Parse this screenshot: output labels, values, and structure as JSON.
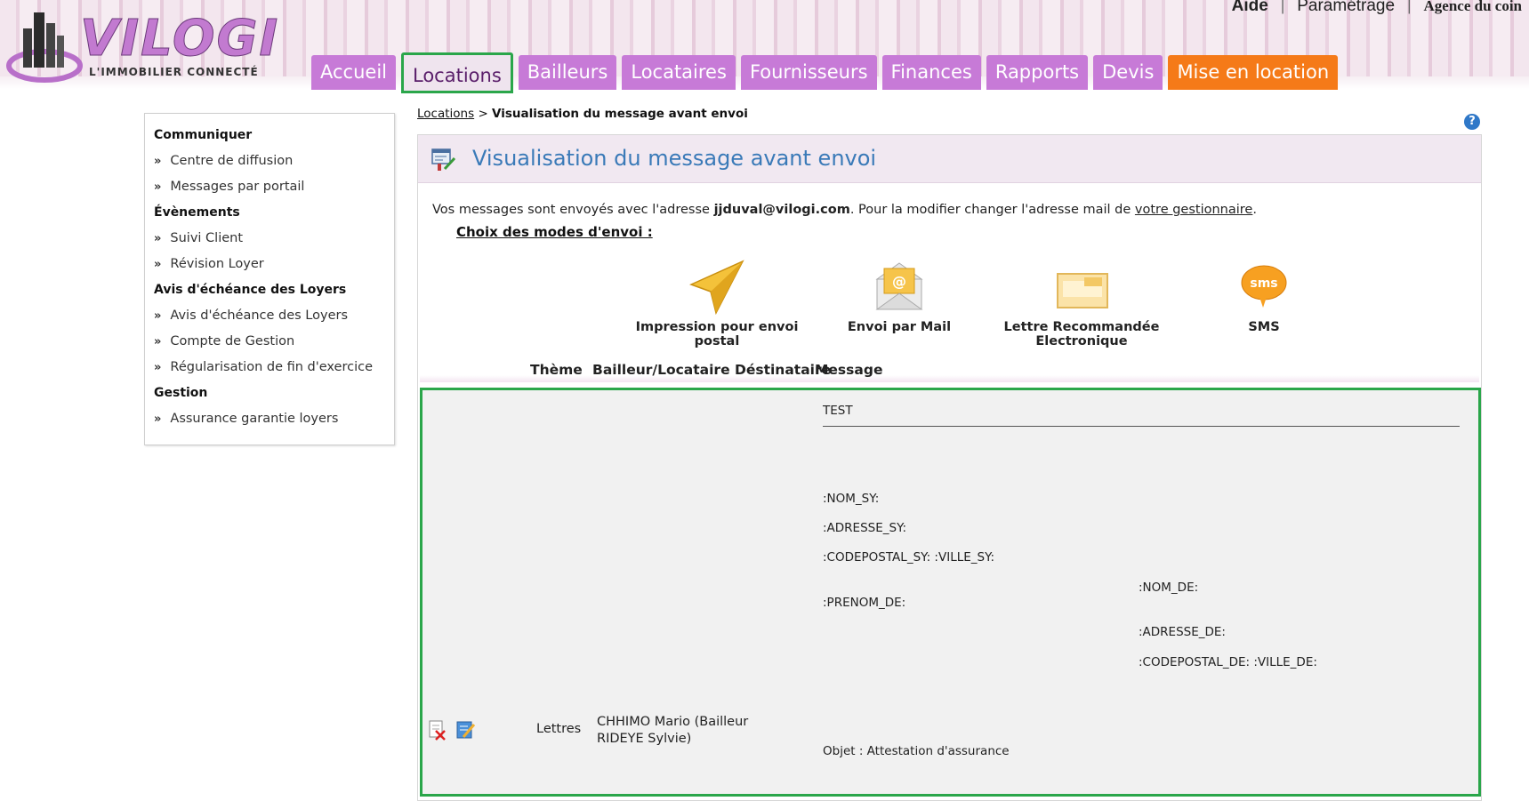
{
  "header": {
    "logo": {
      "brand": "VILOGI",
      "tagline": "L'IMMOBILIER CONNECTÉ"
    },
    "top_links": {
      "aide": "Aide",
      "parametrage": "Paramétrage",
      "agency": "Agence du coin",
      "separator": "|"
    },
    "tabs": [
      {
        "label": "Accueil",
        "state": "normal"
      },
      {
        "label": "Locations",
        "state": "active"
      },
      {
        "label": "Bailleurs",
        "state": "normal"
      },
      {
        "label": "Locataires",
        "state": "normal"
      },
      {
        "label": "Fournisseurs",
        "state": "normal"
      },
      {
        "label": "Finances",
        "state": "normal"
      },
      {
        "label": "Rapports",
        "state": "normal"
      },
      {
        "label": "Devis",
        "state": "normal"
      },
      {
        "label": "Mise en location",
        "state": "highlight"
      }
    ]
  },
  "sidebar": {
    "groups": [
      {
        "title": "Communiquer",
        "items": [
          "Centre de diffusion",
          "Messages par portail"
        ]
      },
      {
        "title": "Évènements",
        "items": [
          "Suivi Client",
          "Révision Loyer"
        ]
      },
      {
        "title": "Avis d'échéance des Loyers",
        "items": [
          "Avis d'échéance des Loyers",
          "Compte de Gestion",
          "Régularisation de fin d'exercice"
        ]
      },
      {
        "title": "Gestion",
        "items": [
          "Assurance garantie loyers"
        ]
      }
    ],
    "bullet": "»"
  },
  "breadcrumb": {
    "link": "Locations",
    "separator": ">",
    "current": "Visualisation du message avant envoi"
  },
  "help_icon": "?",
  "panel": {
    "title": "Visualisation du message avant envoi",
    "info": {
      "prefix": "Vos messages sont envoyés avec l'adresse ",
      "email": "jjduval@vilogi.com",
      "middle": ". Pour la modifier changer l'adresse mail de ",
      "link": "votre gestionnaire",
      "suffix": "."
    },
    "choice_title": "Choix des modes d'envoi :",
    "modes": [
      {
        "label": "Impression pour envoi postal",
        "icon": "paper-plane-icon"
      },
      {
        "label": "Envoi par Mail",
        "icon": "mail-envelope-icon"
      },
      {
        "label": "Lettre Recommandée Electronique",
        "icon": "registered-letter-icon"
      },
      {
        "label": "SMS",
        "icon": "sms-bubble-icon",
        "icon_text": "sms"
      }
    ],
    "columns": {
      "theme": "Thème",
      "dest": "Bailleur/Locataire Déstinataire",
      "message": "Message"
    },
    "row": {
      "theme": "Lettres",
      "destinataire": "CHHIMO Mario (Bailleur RIDEYE Sylvie)",
      "message": {
        "header": "TEST",
        "nom_sy": " :NOM_SY:",
        "adresse_sy": ":ADRESSE_SY:",
        "cp_ville_sy": ":CODEPOSTAL_SY: :VILLE_SY:",
        "nom_de": ":NOM_DE:",
        "prenom_de": ":PRENOM_DE:",
        "adresse_de": ":ADRESSE_DE:",
        "cp_ville_de": ":CODEPOSTAL_DE: :VILLE_DE:",
        "objet": "Objet : Attestation d'assurance"
      }
    }
  },
  "colors": {
    "tab": "#c77ad7",
    "tab_orange": "#f57a18",
    "title_blue": "#3a7ab8",
    "highlight_green": "#2aa64a"
  }
}
